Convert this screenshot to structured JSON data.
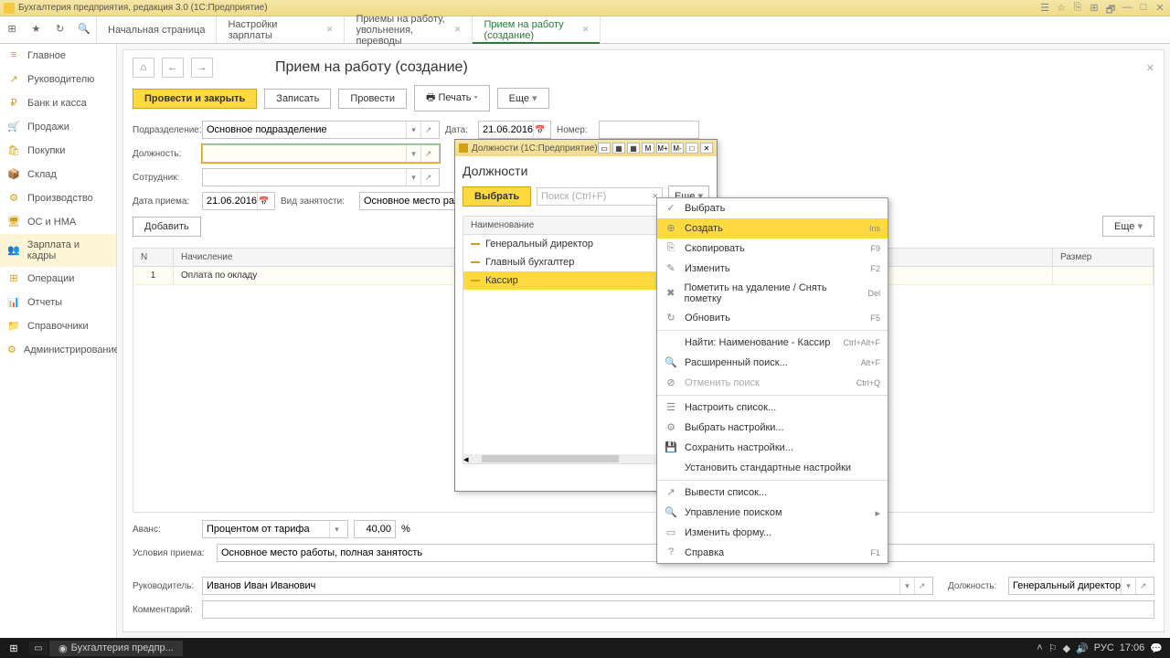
{
  "app_title": "Бухгалтерия предприятия, редакция 3.0  (1С:Предприятие)",
  "tabs": [
    {
      "label": "Начальная страница"
    },
    {
      "label": "Настройки зарплаты"
    },
    {
      "label": "Приемы на работу, увольнения, переводы"
    },
    {
      "label": "Прием на работу (создание)"
    }
  ],
  "sidebar": [
    {
      "label": "Главное",
      "icon": "≡"
    },
    {
      "label": "Руководителю",
      "icon": "↗"
    },
    {
      "label": "Банк и касса",
      "icon": "₽"
    },
    {
      "label": "Продажи",
      "icon": "🛒"
    },
    {
      "label": "Покупки",
      "icon": "🛍"
    },
    {
      "label": "Склад",
      "icon": "📦"
    },
    {
      "label": "Производство",
      "icon": "⚙"
    },
    {
      "label": "ОС и НМА",
      "icon": "🖥"
    },
    {
      "label": "Зарплата и кадры",
      "icon": "👥"
    },
    {
      "label": "Операции",
      "icon": "⊞"
    },
    {
      "label": "Отчеты",
      "icon": "📊"
    },
    {
      "label": "Справочники",
      "icon": "📁"
    },
    {
      "label": "Администрирование",
      "icon": "⚙"
    }
  ],
  "page_title": "Прием на работу (создание)",
  "actions": {
    "post_close": "Провести и закрыть",
    "save": "Записать",
    "post": "Провести",
    "print": "Печать",
    "more": "Еще"
  },
  "form": {
    "l_department": "Подразделение:",
    "department": "Основное подразделение",
    "l_date": "Дата:",
    "date": "21.06.2016",
    "l_number": "Номер:",
    "number": "",
    "l_position": "Должность:",
    "position": "",
    "l_employee": "Сотрудник:",
    "employee": "",
    "l_hiredate": "Дата приема:",
    "hiredate": "21.06.2016",
    "l_emptype": "Вид занятости:",
    "emptype": "Основное место работы",
    "add": "Добавить",
    "l_advance": "Аванс:",
    "advance_type": "Процентом от тарифа",
    "advance_val": "40,00",
    "advance_pct": "%",
    "l_conditions": "Условия приема:",
    "conditions": "Основное место работы, полная занятость",
    "l_manager": "Руководитель:",
    "manager": "Иванов Иван Иванович",
    "l_mgr_pos": "Должность:",
    "mgr_position": "Генеральный директор",
    "l_comment": "Комментарий:",
    "comment": ""
  },
  "accruals_table": {
    "h_n": "N",
    "h_name": "Начисление",
    "h_size": "Размер",
    "row1_n": "1",
    "row1_name": "Оплата по окладу"
  },
  "popup": {
    "win_title": "Должности (1С:Предприятие)",
    "title": "Должности",
    "select": "Выбрать",
    "search_ph": "Поиск (Ctrl+F)",
    "more": "Еще",
    "col": "Наименование",
    "items": [
      "Генеральный директор",
      "Главный бухгалтер",
      "Кассир"
    ]
  },
  "ctx": {
    "choose": "Выбрать",
    "create": "Создать",
    "create_k": "Ins",
    "copy": "Скопировать",
    "copy_k": "F9",
    "edit": "Изменить",
    "edit_k": "F2",
    "mark": "Пометить на удаление / Снять пометку",
    "mark_k": "Del",
    "refresh": "Обновить",
    "refresh_k": "F5",
    "find": "Найти: Наименование - Кассир",
    "find_k": "Ctrl+Alt+F",
    "advfind": "Расширенный поиск...",
    "advfind_k": "Alt+F",
    "cancelfind": "Отменить поиск",
    "cancelfind_k": "Ctrl+Q",
    "cfg": "Настроить список...",
    "selcfg": "Выбрать настройки...",
    "savecfg": "Сохранить настройки...",
    "stdcfg": "Установить стандартные настройки",
    "output": "Вывести список...",
    "searchmgr": "Управление поиском",
    "editform": "Изменить форму...",
    "help": "Справка",
    "help_k": "F1"
  },
  "taskbar": {
    "app": "Бухгалтерия предпр...",
    "lang": "РУС",
    "time": "17:06"
  }
}
